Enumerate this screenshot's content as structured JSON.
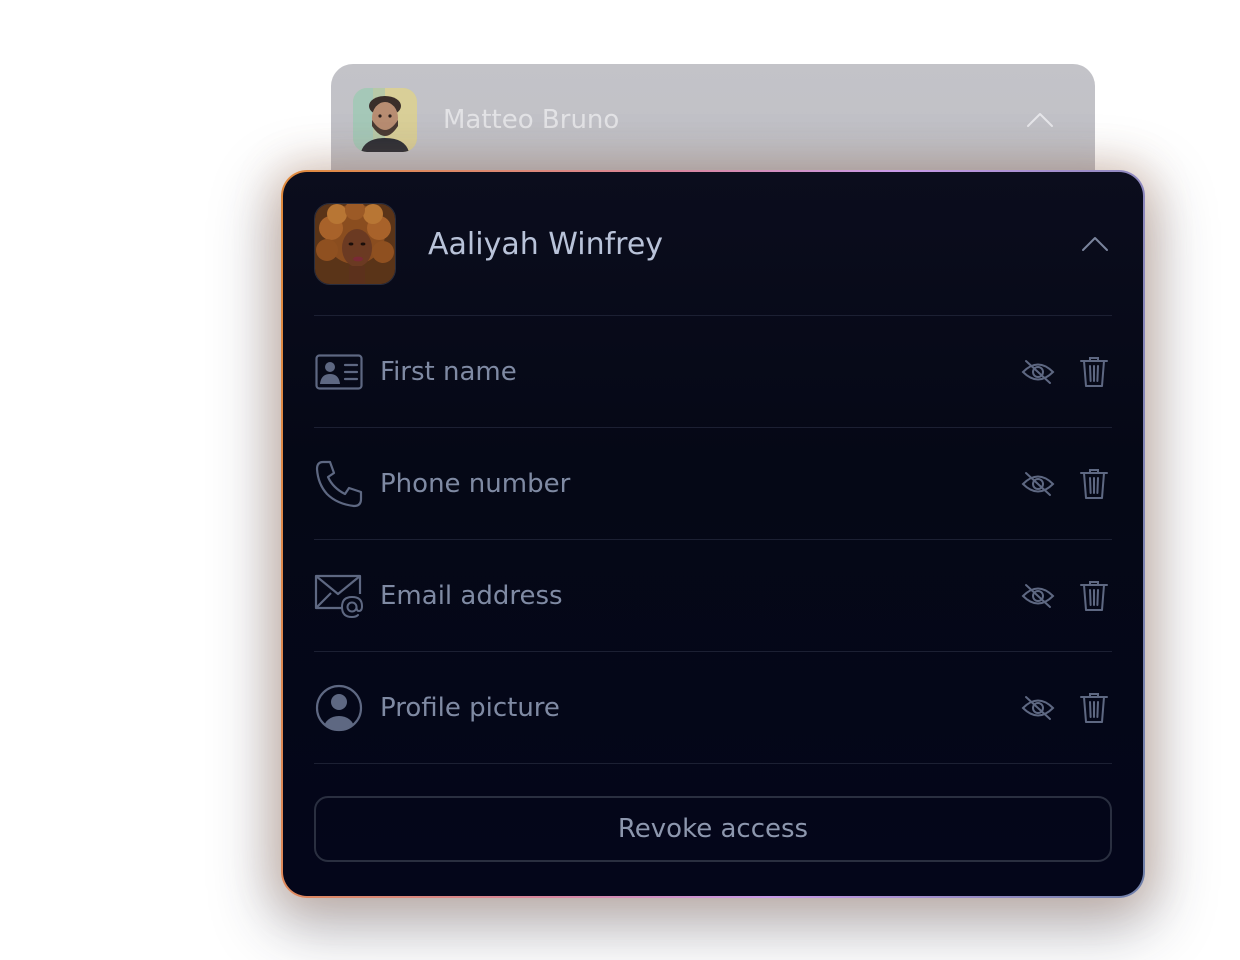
{
  "back_card": {
    "name": "Matteo Bruno",
    "avatar_icon": "person-photo-avatar",
    "chevron_icon": "chevron-up-icon"
  },
  "front_card": {
    "name": "Aaliyah Winfrey",
    "avatar_icon": "person-photo-avatar",
    "chevron_icon": "chevron-up-icon",
    "fields": [
      {
        "label": "First name",
        "icon": "id-card-icon"
      },
      {
        "label": "Phone number",
        "icon": "phone-icon"
      },
      {
        "label": "Email address",
        "icon": "email-at-icon"
      },
      {
        "label": "Profile picture",
        "icon": "user-circle-icon"
      }
    ],
    "row_actions": {
      "hide_icon": "eye-off-icon",
      "delete_icon": "trash-icon"
    },
    "revoke_label": "Revoke access"
  },
  "colors": {
    "card_background": "#050816",
    "label": "#7f8aa3",
    "name": "#b9c3d9",
    "icon_stroke": "#5e6882",
    "border_gradient": [
      "#e08a3c",
      "#d8869f",
      "#c89ae8",
      "#6f7fa8"
    ]
  }
}
